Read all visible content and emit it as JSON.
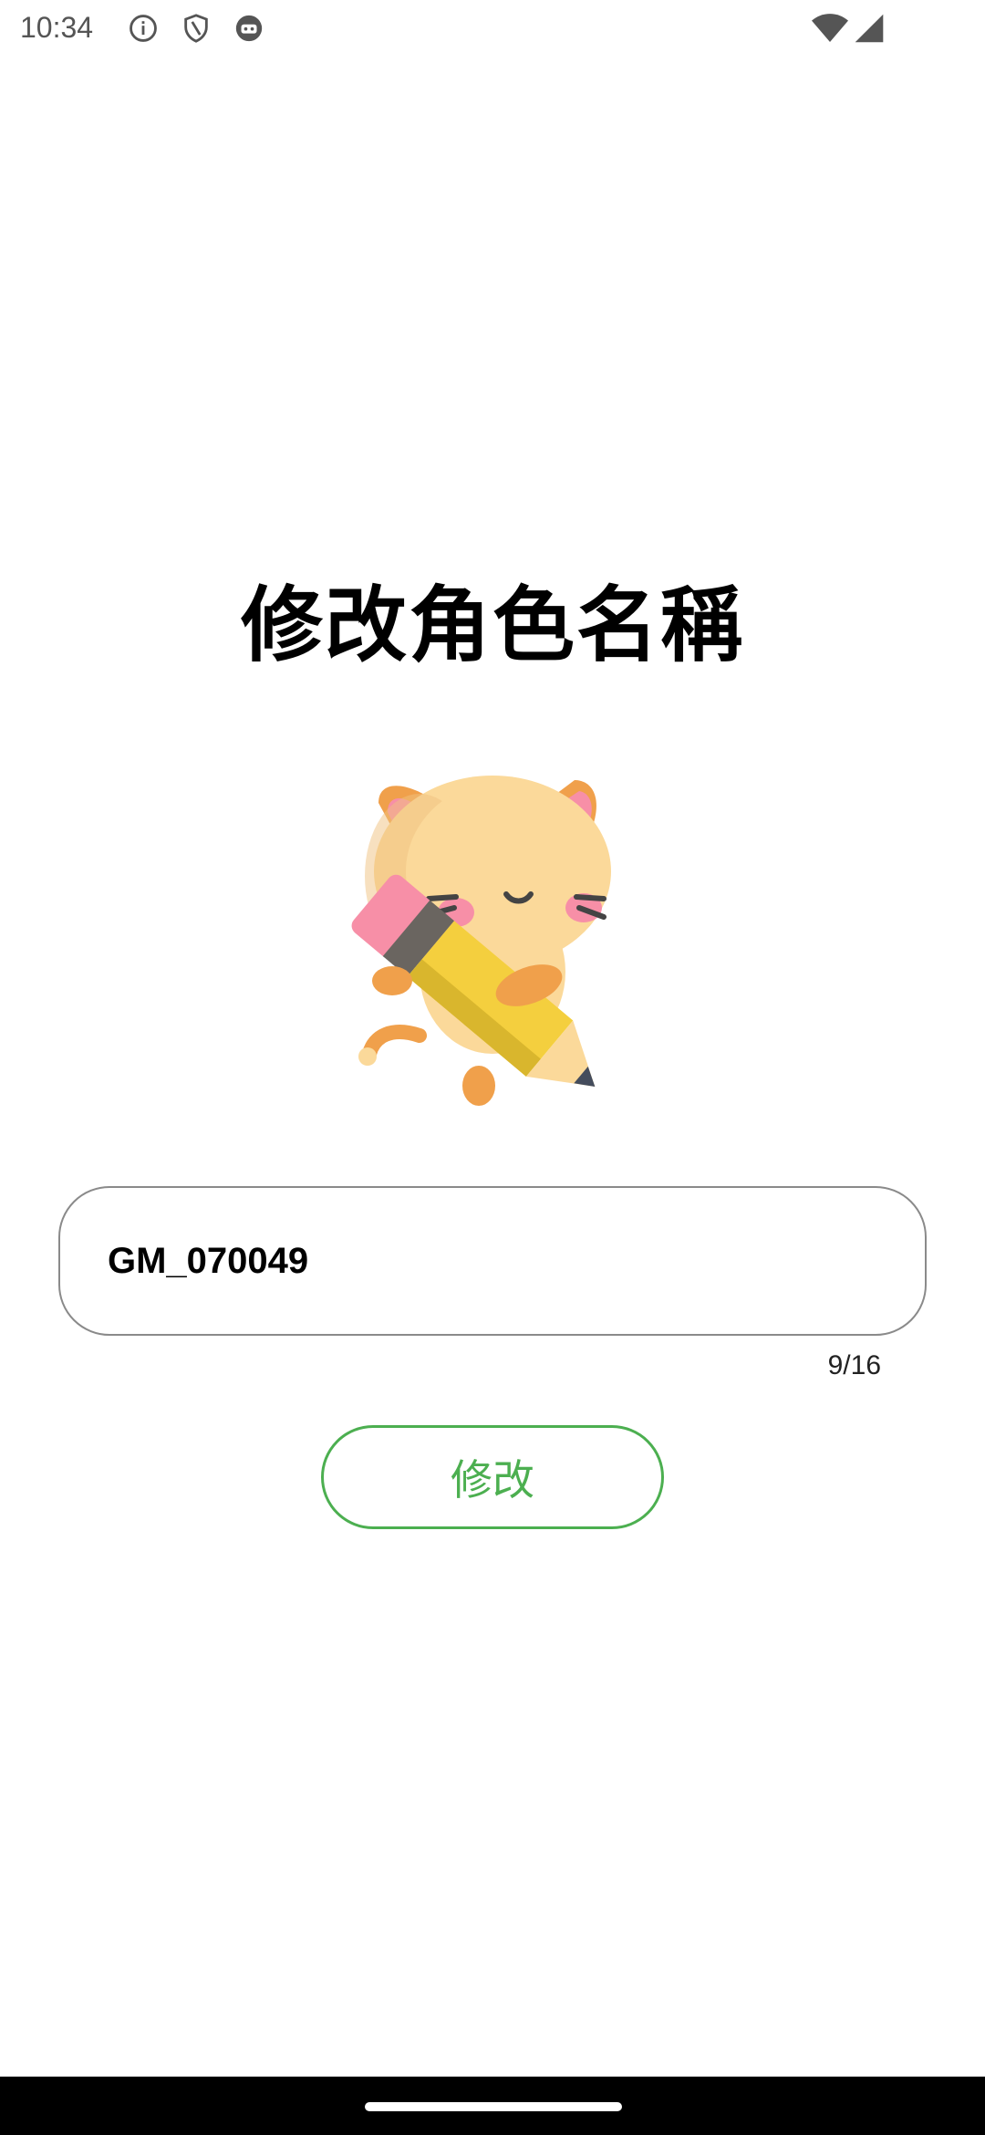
{
  "status_bar": {
    "time": "10:34",
    "left_icons": [
      "info-icon",
      "shield-icon",
      "robot-icon"
    ],
    "right_icons": [
      "wifi-icon",
      "cell-signal-icon"
    ]
  },
  "page": {
    "title": "修改角色名稱",
    "illustration": "cat-holding-pencil-icon"
  },
  "form": {
    "name_value": "GM_070049",
    "char_count": "9/16",
    "submit_label": "修改"
  },
  "colors": {
    "accent": "#4caf50",
    "input_border": "#8a8a8a"
  }
}
